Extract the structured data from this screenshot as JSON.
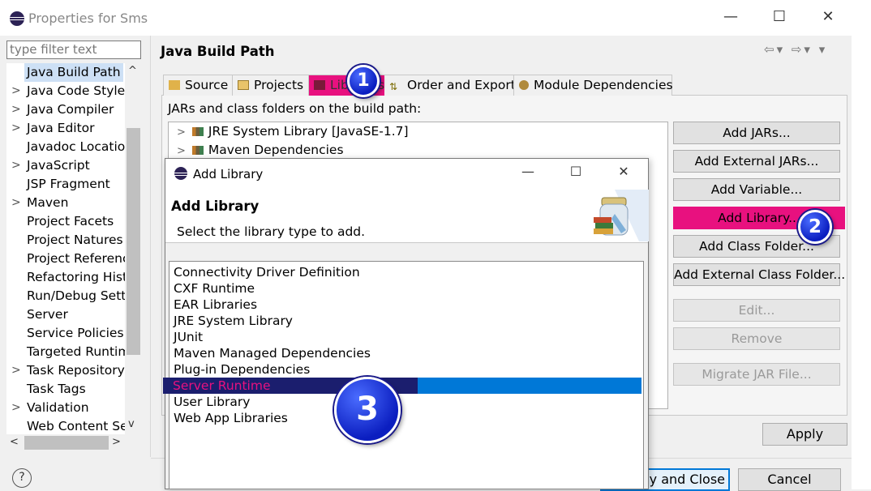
{
  "window": {
    "title": "Properties for Sms",
    "minimize": "—",
    "maximize": "☐",
    "close": "✕"
  },
  "filter": {
    "placeholder": "type filter text"
  },
  "nav": {
    "items": [
      {
        "label": "Java Build Path",
        "expandable": false,
        "selected": true
      },
      {
        "label": "Java Code Style",
        "expandable": true
      },
      {
        "label": "Java Compiler",
        "expandable": true
      },
      {
        "label": "Java Editor",
        "expandable": true
      },
      {
        "label": "Javadoc Location",
        "expandable": false
      },
      {
        "label": "JavaScript",
        "expandable": true
      },
      {
        "label": "JSP Fragment",
        "expandable": false
      },
      {
        "label": "Maven",
        "expandable": true
      },
      {
        "label": "Project Facets",
        "expandable": false
      },
      {
        "label": "Project Natures",
        "expandable": false
      },
      {
        "label": "Project References",
        "expandable": false
      },
      {
        "label": "Refactoring History",
        "expandable": false
      },
      {
        "label": "Run/Debug Settings",
        "expandable": false
      },
      {
        "label": "Server",
        "expandable": false
      },
      {
        "label": "Service Policies",
        "expandable": false
      },
      {
        "label": "Targeted Runtimes",
        "expandable": false
      },
      {
        "label": "Task Repository",
        "expandable": true
      },
      {
        "label": "Task Tags",
        "expandable": false
      },
      {
        "label": "Validation",
        "expandable": true
      },
      {
        "label": "Web Content Settings",
        "expandable": false
      }
    ]
  },
  "page": {
    "title": "Java Build Path",
    "tabs": [
      {
        "label": "Source",
        "icon": "source-folder-icon"
      },
      {
        "label": "Projects",
        "icon": "projects-folder-icon"
      },
      {
        "label": "Libraries",
        "icon": "libraries-icon",
        "active": true
      },
      {
        "label": "Order and Export",
        "icon": "order-export-icon"
      },
      {
        "label": "Module Dependencies",
        "icon": "module-icon"
      }
    ],
    "jars_label": "JARs and class folders on the build path:",
    "tree": [
      {
        "label": "JRE System Library [JavaSE-1.7]"
      },
      {
        "label": "Maven Dependencies"
      }
    ],
    "buttons": {
      "add_jars": "Add JARs...",
      "add_external_jars": "Add External JARs...",
      "add_variable": "Add Variable...",
      "add_library": "Add Library...",
      "add_class_folder": "Add Class Folder...",
      "add_external_class_folder": "Add External Class Folder...",
      "edit": "Edit...",
      "remove": "Remove",
      "migrate_jar": "Migrate JAR File..."
    },
    "apply": "Apply"
  },
  "footer": {
    "apply_and_close": "Apply and Close",
    "cancel": "Cancel"
  },
  "dialog": {
    "title": "Add Library",
    "heading": "Add Library",
    "subtitle": "Select the library type to add.",
    "items": [
      "Connectivity Driver Definition",
      "CXF Runtime",
      "EAR Libraries",
      "JRE System Library",
      "JUnit",
      "Maven Managed Dependencies",
      "Plug-in Dependencies",
      "Server Runtime",
      "User Library",
      "Web App Libraries"
    ],
    "selected_item": "Server Runtime"
  },
  "callouts": {
    "one": "1",
    "two": "2",
    "three": "3"
  },
  "colors": {
    "highlight": "#e8117f",
    "selection": "#0078d7",
    "callout": "#0b1ec0"
  }
}
